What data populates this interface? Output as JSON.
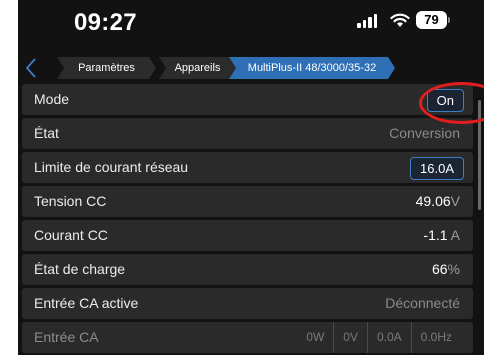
{
  "status": {
    "time": "09:27",
    "battery": "79"
  },
  "nav": {
    "crumbs": [
      "Paramètres",
      "Appareils",
      "MultiPlus-II 48/3000/35-32"
    ]
  },
  "rows": {
    "mode": {
      "label": "Mode",
      "value": "On"
    },
    "etat": {
      "label": "État",
      "value": "Conversion"
    },
    "limite": {
      "label": "Limite de courant réseau",
      "value": "16.0A"
    },
    "tension": {
      "label": "Tension CC",
      "value": "49.06",
      "unit": "V"
    },
    "courant": {
      "label": "Courant CC",
      "value": "-1.1",
      "unit": "A"
    },
    "charge": {
      "label": "État de charge",
      "value": "66",
      "unit": "%"
    },
    "entree_active": {
      "label": "Entrée CA active",
      "value": "Déconnecté"
    },
    "entree": {
      "label": "Entrée CA",
      "cells": [
        "0W",
        "0V",
        "0.0A",
        "0.0Hz"
      ]
    }
  },
  "colors": {
    "accent": "#2e6fb5",
    "highlight": "#e21d1d"
  }
}
